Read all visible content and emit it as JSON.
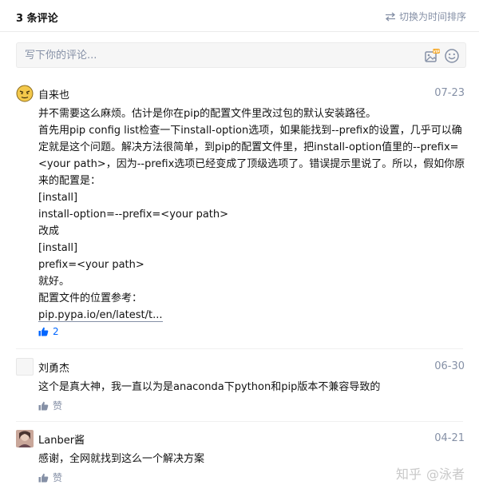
{
  "header": {
    "title": "3 条评论",
    "sort_label": "切换为时间排序",
    "sort_icon": "swap-arrows-icon"
  },
  "composer": {
    "placeholder": "写下你的评论...",
    "image_icon": "image-vip-icon",
    "emoji_icon": "emoji-icon"
  },
  "comments": [
    {
      "author": "自来也",
      "date": "07-23",
      "avatar": "cartoon-face",
      "lines": [
        "并不需要这么麻烦。估计是你在pip的配置文件里改过包的默认安装路径。",
        "首先用pip config list检查一下install-option选项，如果能找到--prefix的设置，几乎可以确",
        "定就是这个问题。解决方法很简单，到pip的配置文件里，把install-option值里的--prefix=",
        "<your path>，因为--prefix选项已经变成了顶级选项了。错误提示里说了。所以，假如你原",
        "来的配置是：",
        "[install]",
        "install-option=--prefix=<your path>",
        "改成",
        "[install]",
        "prefix=<your path>",
        "就好。",
        "配置文件的位置参考："
      ],
      "link": "pip.pypa.io/en/latest/t...",
      "likes": "2",
      "liked": true
    },
    {
      "author": "刘勇杰",
      "date": "06-30",
      "avatar": "blank",
      "text": "这个是真大神，我一直以为是anaconda下python和pip版本不兼容导致的",
      "like_label": "赞"
    },
    {
      "author": "Lanber酱",
      "date": "04-21",
      "avatar": "photo",
      "text": "感谢，全网就找到这么一个解决方案",
      "like_label": "赞"
    }
  ],
  "watermark": {
    "site": "知乎",
    "user": "@泳者"
  },
  "colors": {
    "accent": "#0066ff",
    "muted": "#8590a6",
    "text": "#121212"
  }
}
